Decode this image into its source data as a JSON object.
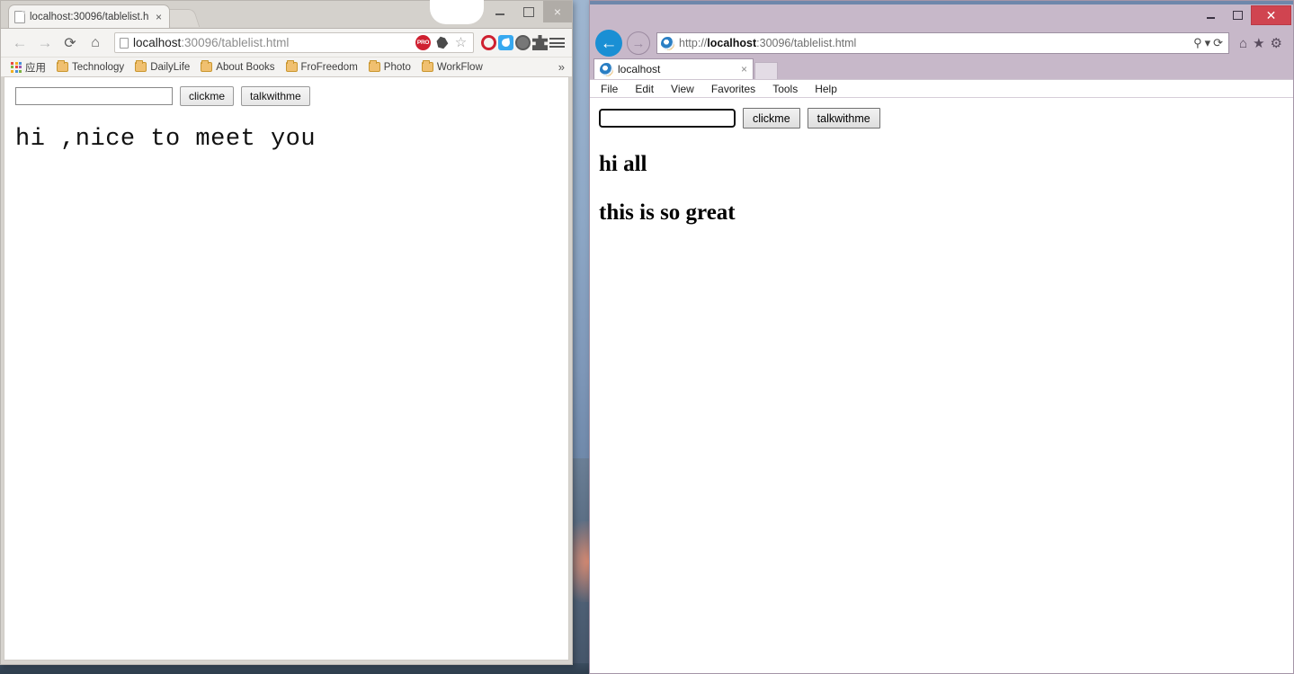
{
  "desktop": {
    "taskbar_visible": true
  },
  "chrome": {
    "tab": {
      "title": "localhost:30096/tablelist.h",
      "close_label": "×",
      "favicon": "page-icon"
    },
    "window_controls": {
      "minimize": "",
      "maximize": "",
      "close": "×"
    },
    "toolbar": {
      "back": "←",
      "forward": "→",
      "reload": "⟳",
      "home": "⌂",
      "url_prefix": "localhost",
      "url_suffix": ":30096/tablelist.html",
      "icons": [
        "pro-badge-icon",
        "ghost-icon",
        "star-icon",
        "opera-icon",
        "blue-pencil-icon",
        "film-reel-icon",
        "puzzle-icon",
        "hamburger-menu-icon"
      ]
    },
    "bookmarks": {
      "apps_label": "应用",
      "items": [
        {
          "label": "Technology"
        },
        {
          "label": "DailyLife"
        },
        {
          "label": "About Books"
        },
        {
          "label": "FroFreedom"
        },
        {
          "label": "Photo"
        },
        {
          "label": "WorkFlow"
        }
      ],
      "overflow": "»"
    },
    "page": {
      "input_value": "",
      "input_placeholder": "",
      "button_clickme": "clickme",
      "button_talkwithme": "talkwithme",
      "message": "hi ,nice to meet you"
    }
  },
  "ie": {
    "window_controls": {
      "minimize": "",
      "maximize": "",
      "close": "✕"
    },
    "nav": {
      "back": "←",
      "forward": "→",
      "url_prefix": "http://",
      "url_host": "localhost",
      "url_suffix": ":30096/tablelist.html",
      "search_icon": "⚲",
      "search_dropdown": "▾",
      "refresh_icon": "⟳",
      "home_icon": "⌂",
      "favorites_icon": "★",
      "tools_icon": "⚙"
    },
    "tab": {
      "title": "localhost",
      "close_label": "×"
    },
    "menubar": [
      "File",
      "Edit",
      "View",
      "Favorites",
      "Tools",
      "Help"
    ],
    "page": {
      "input_value": "",
      "input_placeholder": "",
      "button_clickme": "clickme",
      "button_talkwithme": "talkwithme",
      "heading1": "hi all",
      "heading2": "this is so great"
    }
  }
}
